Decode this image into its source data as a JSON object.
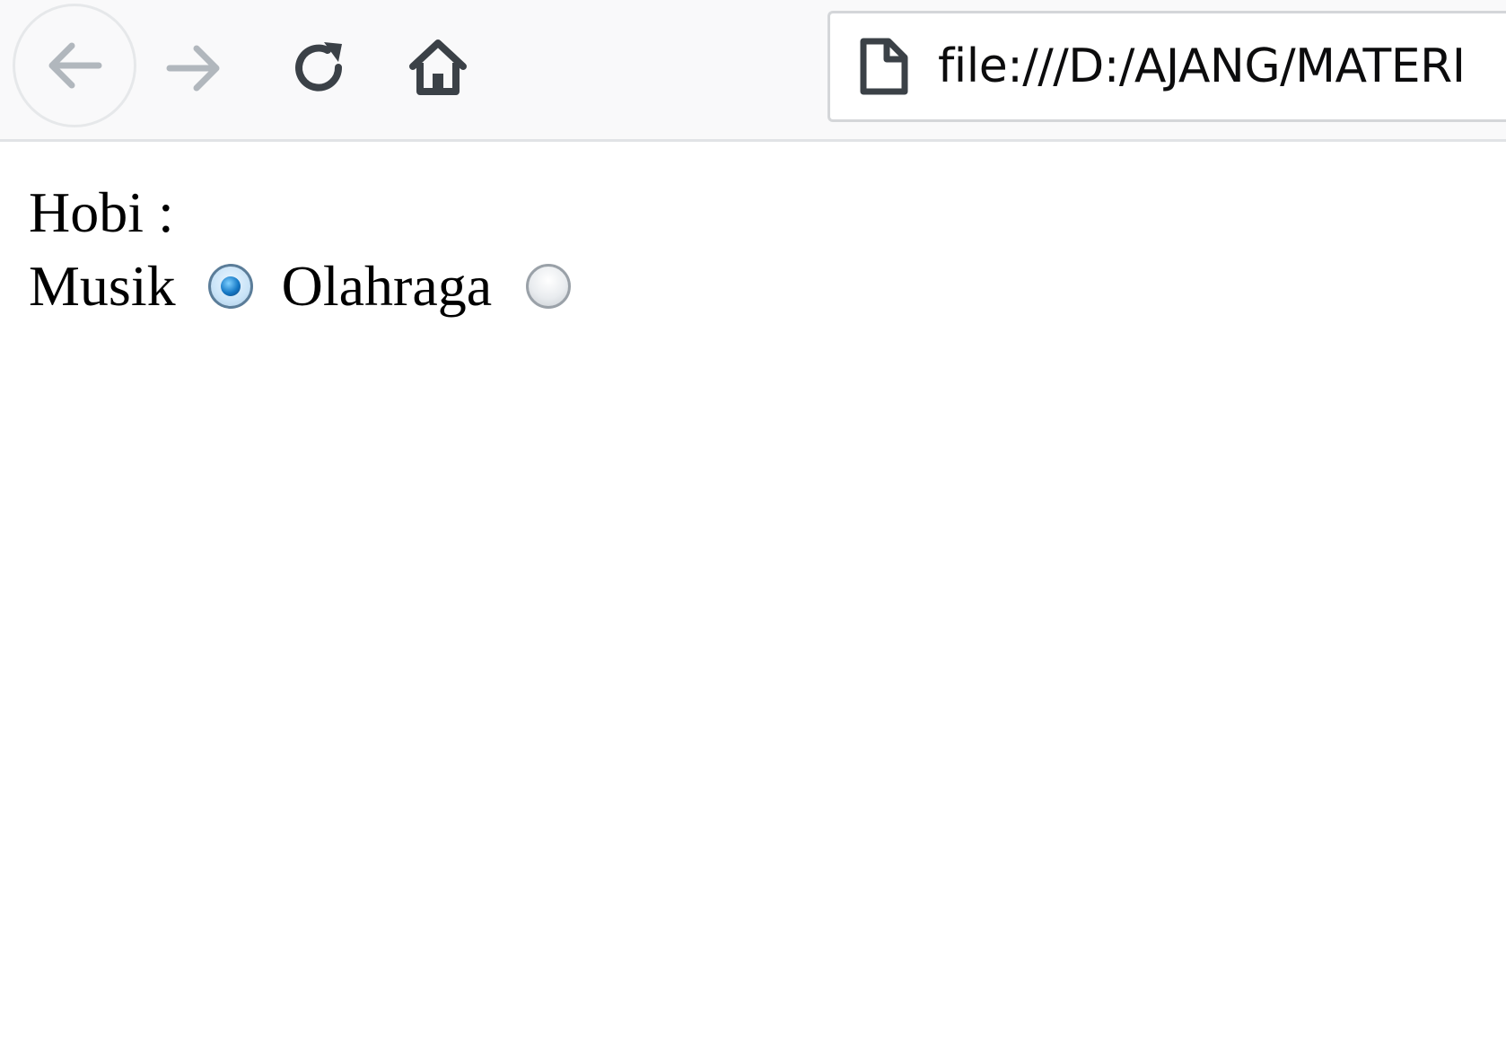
{
  "browser": {
    "url": "file:///D:/AJANG/MATERI",
    "icons": {
      "back": "back-arrow-icon",
      "forward": "forward-arrow-icon",
      "reload": "reload-icon",
      "home": "home-icon",
      "page": "page-icon"
    },
    "colors": {
      "toolbar_bg": "#f9f9fa",
      "icon_dark": "#3b4147",
      "icon_disabled": "#b1b7bd"
    }
  },
  "form": {
    "label": "Hobi :",
    "options": [
      {
        "label": "Musik",
        "checked": true
      },
      {
        "label": "Olahraga",
        "checked": false
      }
    ]
  }
}
